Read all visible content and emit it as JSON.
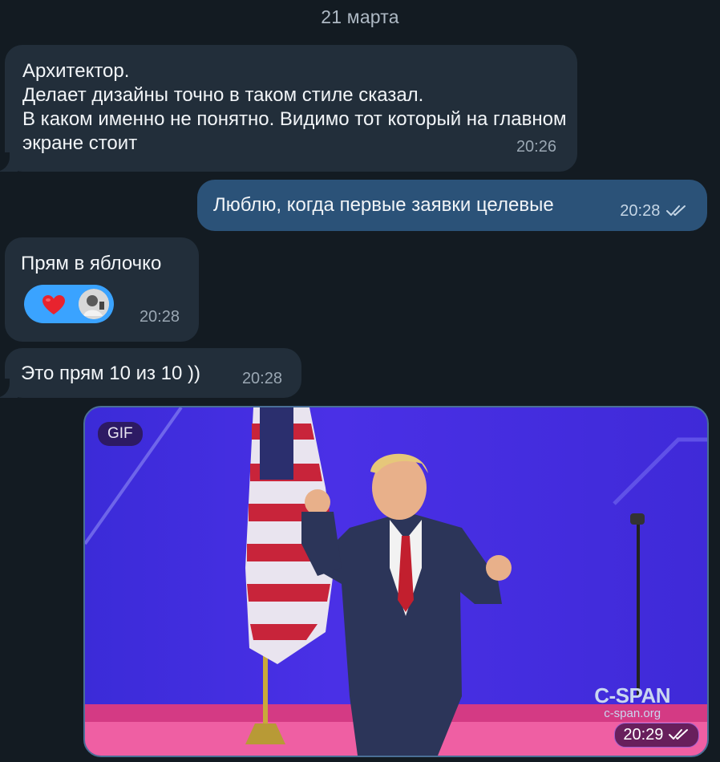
{
  "date_separator": "21 марта",
  "messages": [
    {
      "direction": "in",
      "text": "Архитектор.\nДелает дизайны точно в таком стиле сказал.\nВ каком именно не  понятно. Видимо тот который на главном экране стоит",
      "time": "20:26"
    },
    {
      "direction": "out",
      "text": "Люблю, когда первые заявки целевые",
      "time": "20:28",
      "status": "read"
    },
    {
      "direction": "in",
      "text": "Прям в яблочко",
      "time": "20:28",
      "reaction": {
        "emoji": "heart",
        "count_avatars": 1
      }
    },
    {
      "direction": "in",
      "text": "Это прям 10 из 10 ))",
      "time": "20:28"
    },
    {
      "direction": "out",
      "type": "gif",
      "badge": "GIF",
      "watermark_main": "C-SPAN",
      "watermark_sub": "c-span.org",
      "time": "20:29",
      "status": "read"
    }
  ],
  "colors": {
    "background": "#131b22",
    "incoming_bubble": "#222e3a",
    "outgoing_bubble": "#2b5278",
    "reaction_pill": "#3aa3ff",
    "heart": "#e8232e"
  }
}
